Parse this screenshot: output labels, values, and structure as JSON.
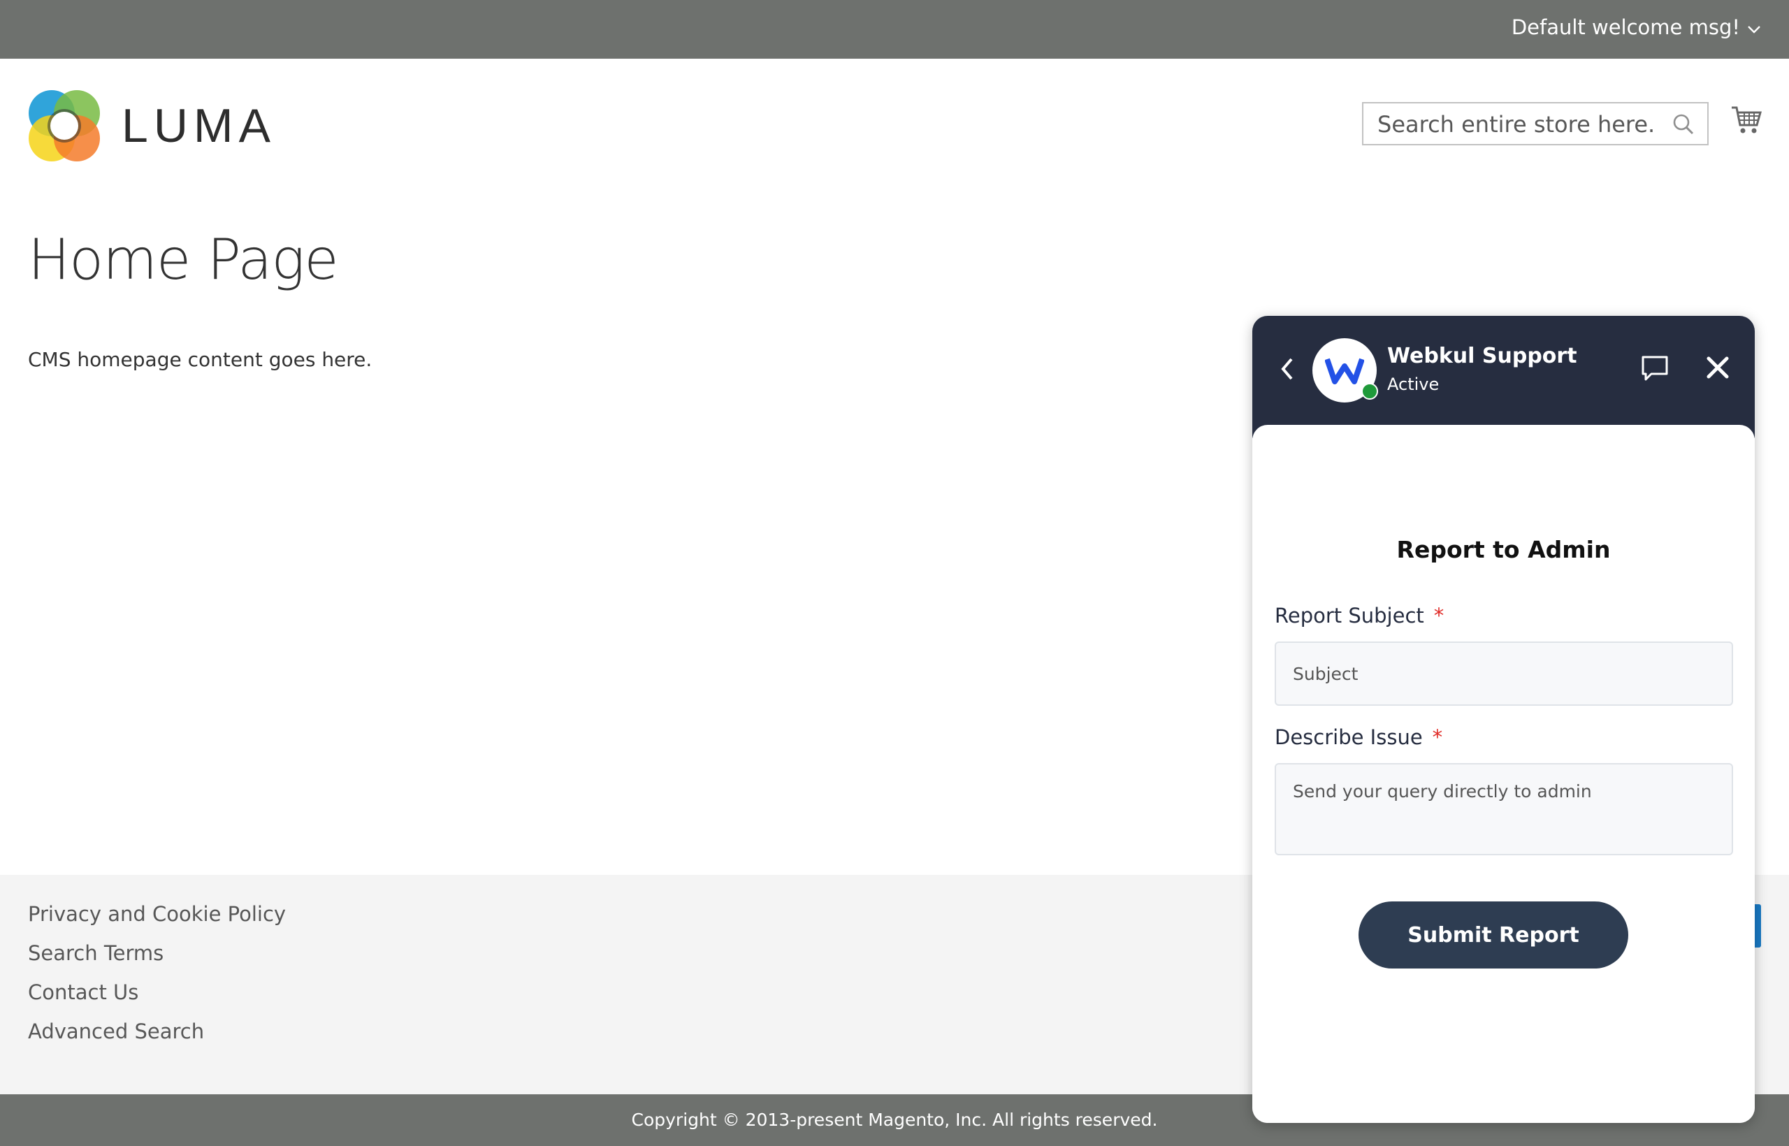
{
  "topbar": {
    "welcome": "Default welcome msg!"
  },
  "header": {
    "logo_text": "LUMA",
    "search": {
      "placeholder": "Search entire store here..."
    }
  },
  "main": {
    "title": "Home Page",
    "content": "CMS homepage content goes here."
  },
  "footer": {
    "links": [
      "Privacy and Cookie Policy",
      "Search Terms",
      "Contact Us",
      "Advanced Search"
    ],
    "copyright": "Copyright © 2013-present Magento, Inc. All rights reserved."
  },
  "chat": {
    "agent_name": "Webkul Support",
    "agent_status": "Active",
    "report_title": "Report to Admin",
    "subject_label": "Report Subject",
    "subject_placeholder": "Subject",
    "issue_label": "Describe Issue",
    "issue_placeholder": "Send your query directly to admin",
    "required_mark": "*",
    "submit_label": "Submit Report"
  },
  "colors": {
    "topbar": "#6e716e",
    "chat_header": "#262d40",
    "submit_button": "#2e3d52",
    "online": "#1f9a3a",
    "required": "#e02b27"
  },
  "icons": [
    "chevron-down-icon",
    "search-icon",
    "cart-icon",
    "back-icon",
    "webkul-logo",
    "chat-bubble-icon",
    "close-icon"
  ]
}
